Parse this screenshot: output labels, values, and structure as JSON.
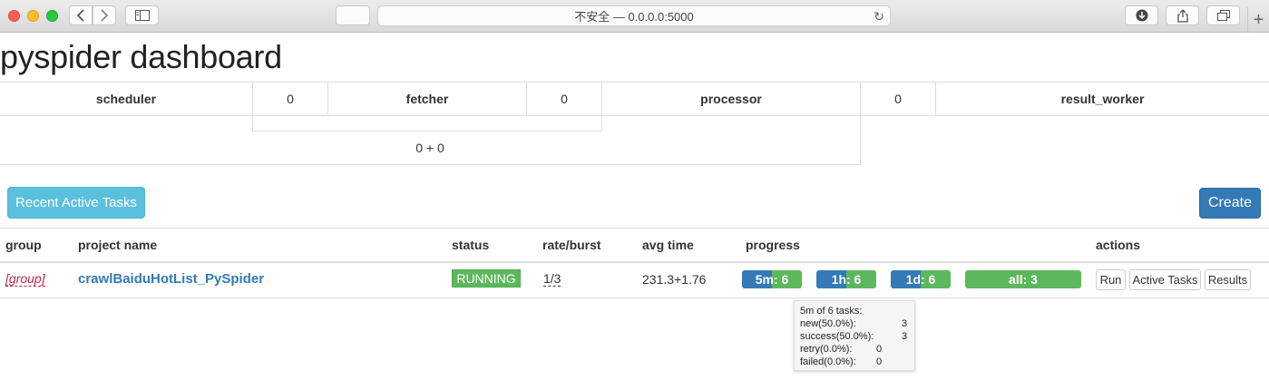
{
  "browser": {
    "address": "不安全 — 0.0.0.0:5000",
    "new_tab": "+"
  },
  "page": {
    "title": "pyspider dashboard"
  },
  "components": {
    "scheduler": {
      "label": "scheduler",
      "queue": "0"
    },
    "fetcher": {
      "label": "fetcher",
      "queue": "0"
    },
    "processor": {
      "label": "processor",
      "queue": "0"
    },
    "result_worker": {
      "label": "result_worker"
    },
    "fetcher_rate": "0 + 0"
  },
  "buttons": {
    "recent_active_tasks": "Recent Active Tasks",
    "create": "Create"
  },
  "table": {
    "headers": {
      "group": "group",
      "project_name": "project name",
      "status": "status",
      "rate_burst": "rate/burst",
      "avg_time": "avg time",
      "progress": "progress",
      "actions": "actions"
    },
    "rows": [
      {
        "group": "[group]",
        "project_name": "crawlBaiduHotList_PySpider",
        "status": "RUNNING",
        "rate_burst": "1/3",
        "avg_time": "231.3+1.76",
        "progress": {
          "5m": {
            "label": "5m: 6",
            "new_fraction": 0.5,
            "success_fraction": 0.5
          },
          "1h": {
            "label": "1h: 6",
            "new_fraction": 0.5,
            "success_fraction": 0.5
          },
          "1d": {
            "label": "1d: 6",
            "new_fraction": 0.5,
            "success_fraction": 0.5
          },
          "all": {
            "label": "all: 3",
            "new_fraction": 0.0,
            "success_fraction": 1.0
          }
        },
        "actions": {
          "run": "Run",
          "active_tasks": "Active Tasks",
          "results": "Results"
        }
      }
    ]
  },
  "tooltip": {
    "title": "5m of 6 tasks:",
    "lines": [
      {
        "label": "new(50.0%):",
        "value": "3"
      },
      {
        "label": "success(50.0%):",
        "value": "3"
      },
      {
        "label": "retry(0.0%):",
        "value": "0"
      },
      {
        "label": "failed(0.0%):",
        "value": "0"
      }
    ]
  },
  "colors": {
    "new": "#337ab7",
    "success": "#5cb85c",
    "running": "#5cb85c",
    "link": "#337ab7",
    "group": "#c7254e",
    "info_button": "#5bc0de",
    "primary_button": "#337ab7"
  },
  "icons": [
    "back-icon",
    "forward-icon",
    "sidebar-icon",
    "reload-icon",
    "download-icon",
    "share-icon",
    "tabs-icon"
  ]
}
